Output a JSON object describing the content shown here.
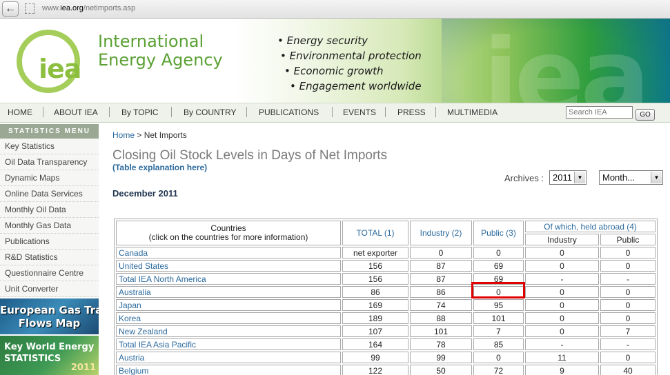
{
  "browser": {
    "url_prefix": "www.",
    "url_domain": "iea.org",
    "url_path": "/netimports.asp",
    "back_glyph": "←"
  },
  "header": {
    "logo_text": "iea",
    "org_name_line1": "International",
    "org_name_line2": "Energy Agency",
    "taglines": [
      "• Energy security",
      "• Environmental protection",
      "• Economic growth",
      "• Engagement worldwide"
    ],
    "watermark": "iea"
  },
  "nav": {
    "items": [
      "HOME",
      "ABOUT IEA",
      "By TOPIC",
      "By COUNTRY",
      "PUBLICATIONS",
      "EVENTS",
      "PRESS",
      "MULTIMEDIA"
    ],
    "search_placeholder": "Search IEA",
    "go_label": "GO"
  },
  "sidebar": {
    "header": "STATISTICS MENU",
    "items": [
      "Key Statistics",
      "Oil Data Transparency",
      "Dynamic Maps",
      "Online Data Services",
      "Monthly Oil Data",
      "Monthly Gas Data",
      "Publications",
      "R&D Statistics",
      "Questionnaire Centre",
      "Unit Converter"
    ],
    "promo_gas_line1": "European Gas Trade",
    "promo_gas_line2": "Flows Map",
    "promo_kwes_line1": "Key World Energy",
    "promo_kwes_line2": "STATISTICS",
    "promo_kwes_year": "2011"
  },
  "main": {
    "breadcrumb_home": "Home",
    "breadcrumb_sep": " > ",
    "breadcrumb_current": "Net Imports",
    "title": "Closing Oil Stock Levels in Days of Net Imports",
    "explanation_link": "(Table explanation here)",
    "archives_label": "Archives :",
    "archive_year": "2011",
    "archive_month": "Month...",
    "period_heading": "December 2011"
  },
  "table": {
    "col_countries_line1": "Countries",
    "col_countries_line2": "(click on the countries for more information)",
    "col_total": "TOTAL (1)",
    "col_industry": "Industry (2)",
    "col_public": "Public (3)",
    "col_abroad": "Of which, held abroad (4)",
    "col_abroad_industry": "Industry",
    "col_abroad_public": "Public",
    "rows": [
      [
        "Canada",
        "net exporter",
        "0",
        "0",
        "0",
        "0"
      ],
      [
        "United States",
        "156",
        "87",
        "69",
        "0",
        "0"
      ],
      [
        "Total IEA North America",
        "156",
        "87",
        "69",
        "-",
        "-"
      ],
      [
        "Australia",
        "86",
        "86",
        "0",
        "0",
        "0"
      ],
      [
        "Japan",
        "169",
        "74",
        "95",
        "0",
        "0"
      ],
      [
        "Korea",
        "189",
        "88",
        "101",
        "0",
        "0"
      ],
      [
        "New Zealand",
        "107",
        "101",
        "7",
        "0",
        "7"
      ],
      [
        "Total IEA Asia Pacific",
        "164",
        "78",
        "85",
        "-",
        "-"
      ],
      [
        "Austria",
        "99",
        "99",
        "0",
        "11",
        "0"
      ],
      [
        "Belgium",
        "122",
        "50",
        "72",
        "9",
        "40"
      ]
    ]
  },
  "colors": {
    "link_blue": "#2b6a9e",
    "iea_green": "#5aa033",
    "highlight_red": "#e00000"
  }
}
